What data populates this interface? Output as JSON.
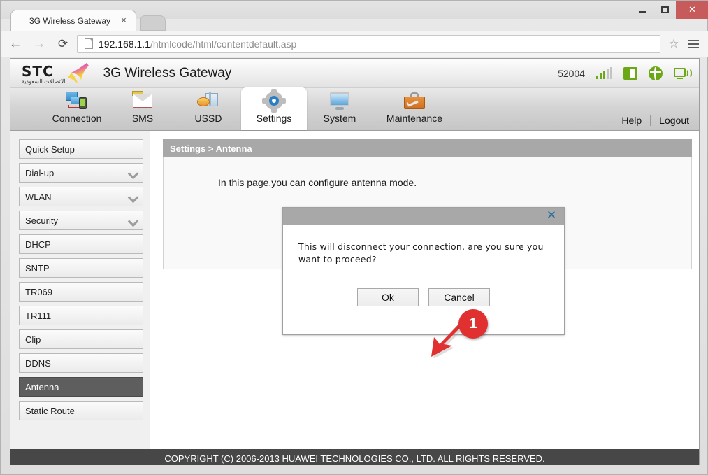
{
  "browser": {
    "tab_title": "3G Wireless Gateway",
    "tab_close": "×",
    "url_host": "192.168.1.1",
    "url_path": "/htmlcode/html/contentdefault.asp",
    "back_glyph": "←",
    "forward_glyph": "→",
    "reload_glyph": "⟳",
    "star_glyph": "☆",
    "minimize_glyph": "",
    "maximize_glyph": "",
    "close_glyph": "✕"
  },
  "router": {
    "brand_en": "STC",
    "brand_ar": "الاتصالات السعودية",
    "title": "3G Wireless Gateway",
    "device_number": "52004"
  },
  "nav": {
    "items": [
      {
        "label": "Connection",
        "active": false
      },
      {
        "label": "SMS",
        "active": false
      },
      {
        "label": "USSD",
        "active": false
      },
      {
        "label": "Settings",
        "active": true
      },
      {
        "label": "System",
        "active": false
      },
      {
        "label": "Maintenance",
        "active": false
      }
    ],
    "help": "Help",
    "logout": "Logout"
  },
  "sidebar": {
    "items": [
      {
        "label": "Quick Setup",
        "expandable": false,
        "selected": false
      },
      {
        "label": "Dial-up",
        "expandable": true,
        "selected": false
      },
      {
        "label": "WLAN",
        "expandable": true,
        "selected": false
      },
      {
        "label": "Security",
        "expandable": true,
        "selected": false
      },
      {
        "label": "DHCP",
        "expandable": false,
        "selected": false
      },
      {
        "label": "SNTP",
        "expandable": false,
        "selected": false
      },
      {
        "label": "TR069",
        "expandable": false,
        "selected": false
      },
      {
        "label": "TR111",
        "expandable": false,
        "selected": false
      },
      {
        "label": "Clip",
        "expandable": false,
        "selected": false
      },
      {
        "label": "DDNS",
        "expandable": false,
        "selected": false
      },
      {
        "label": "Antenna",
        "expandable": false,
        "selected": true
      },
      {
        "label": "Static Route",
        "expandable": false,
        "selected": false
      }
    ]
  },
  "main": {
    "breadcrumb": "Settings > Antenna",
    "description": "In this page,you can configure antenna mode."
  },
  "dialog": {
    "message": "This will disconnect your connection, are you sure you want to proceed?",
    "ok_label": "Ok",
    "cancel_label": "Cancel",
    "close_glyph": "✕"
  },
  "annotation": {
    "step_number": "1",
    "color": "#e03030"
  },
  "footer": {
    "copyright": "COPYRIGHT (C) 2006-2013 HUAWEI TECHNOLOGIES CO., LTD. ALL RIGHTS RESERVED."
  },
  "colors": {
    "accent_green": "#6aa815",
    "selected_gray": "#5e5e5e",
    "breadcrumb_gray": "#a8a8a8",
    "footer_dark": "#474747",
    "close_red": "#c75b5b"
  }
}
